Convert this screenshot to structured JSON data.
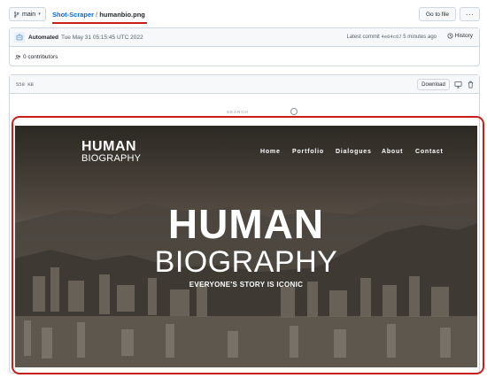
{
  "toolbar": {
    "branch": "main",
    "repo": "Shot-Scraper",
    "separator": "/",
    "file": "humanbio.png",
    "goto_label": "Go to file",
    "more_label": "···"
  },
  "commit": {
    "author": "Automated",
    "date": "Tue May 31 05:15:45 UTC 2022",
    "latest_label": "Latest commit",
    "sha": "4e64c67",
    "ago": "5 minutes ago",
    "history_label": "History"
  },
  "contributors": {
    "label": "0 contributors"
  },
  "file": {
    "size": "558 KB",
    "download_label": "Download"
  },
  "preview": {
    "search_text": "SEARCH",
    "logo_line1": "HUMAN",
    "logo_line2": "BIOGRAPHY",
    "nav": [
      "Home",
      "Portfolio",
      "Dialogues",
      "About",
      "Contact"
    ],
    "headline1": "HUMAN",
    "headline2": "BIOGRAPHY",
    "tagline": "EVERYONE'S STORY IS ICONIC"
  },
  "colors": {
    "accent": "#0969da",
    "highlight": "#c81e1e"
  }
}
